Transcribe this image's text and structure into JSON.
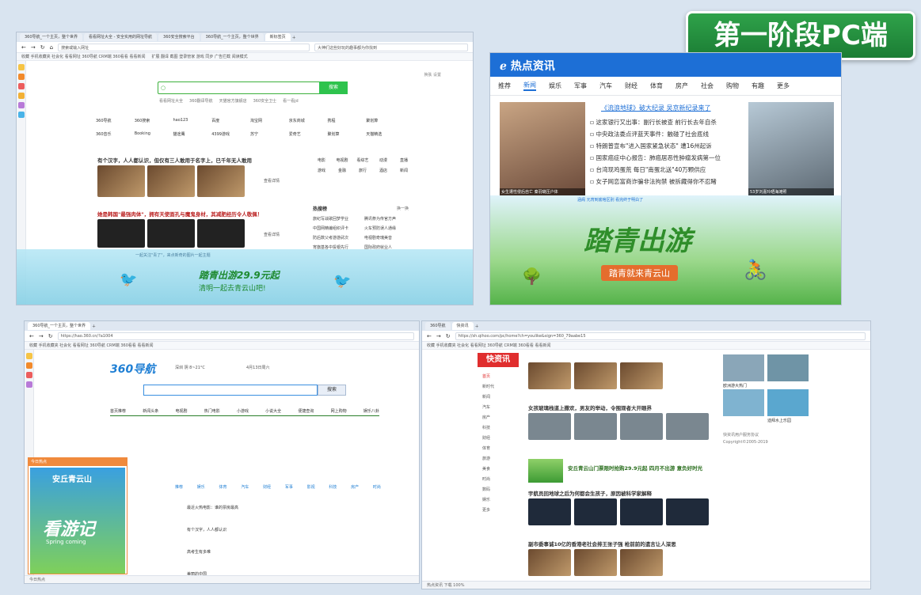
{
  "badge": "第一阶段PC端",
  "win1": {
    "tabs": [
      "360导航_一个主页，整个世界",
      "看看网址大全 - 安全实用的网址导航",
      "360安全搜索平台",
      "360导航_一个主页，整个世界",
      "新标签页"
    ],
    "url": "搜索或输入网址",
    "url_right": "大神们这些好玩的趣事都为你找到",
    "favs": "收藏  手机收藏夹  社会化  看看网址  360导航  CRM端  360看看  看看新闻",
    "fav_right": "扩展  翻译  截图  登录管家  游戏  同步  广告拦截  阅读模式",
    "top_right": "换肤   设置",
    "search_button": "搜索",
    "search_links": [
      "看看网址大全",
      "360翻译导航",
      "天猫官方旗舰店",
      "360安全卫士",
      "看一看jd"
    ],
    "sites_row1": [
      "360导航",
      "360搜索",
      "hao123",
      "百度",
      "淘宝网",
      "京东商城",
      "携程",
      "聚划算"
    ],
    "sites_row2": [
      "360音乐",
      "Booking",
      "猫途鹰",
      "4399游戏",
      "苏宁",
      "爱奇艺",
      "聚划算",
      "天猫精选"
    ],
    "headline1": "有个汉字，人人都认识，但仅有三人敢用于名字上，已千年无人敢用",
    "headline2": "她是韩国\"最强肉体\"，拥有天使面孔与魔鬼身材，其减肥经历令人敬佩！",
    "view_detail": "查看详情",
    "grid_icons": [
      "电影",
      "电视剧",
      "看综艺",
      "动漫",
      "直播",
      "游戏",
      "金融",
      "旅行",
      "酒店",
      "新闻"
    ],
    "hot_title": "热搜榜",
    "hot_refresh": "换一换",
    "hot_items": [
      "旅纪写战歌回梦学业",
      "腾讯祭为传官方声",
      "中国网精编组织评卡",
      "火车预防误人通缘",
      "防后数父考游游武次",
      "电视剧奇瑰美音",
      "宵旗基各中投银先行",
      "国际政府就业人"
    ],
    "banner_text": "踏青出游29.9元起",
    "banner_sub": "清明一起去青云山吧!",
    "ad_text": "一起关注\"青了\"，来点新奇的图片一起主题"
  },
  "news": {
    "brand": "热点资讯",
    "tabs": [
      "推荐",
      "新闻",
      "娱乐",
      "军事",
      "汽车",
      "财经",
      "体育",
      "房产",
      "社会",
      "购物",
      "有趣",
      "更多"
    ],
    "headline": "《流浪地球》破大纪录 吴京新纪录来了",
    "items": [
      "这家银行又出事：副行长被查 前行长去年自杀",
      "中央政法委点评蓝天事件：触碰了社会底线",
      "特朗普宣布\"进入国家紧急状态\" 遭16州起诉",
      "国家癌症中心报告：肺癌居恶性肿瘤发病第一位",
      "台湾现鸡蛋荒 每日\"南蛋北送\"40万颗供应",
      "女子网恋富商诈骗非法拘禁 被拆藏得你不忍睹"
    ],
    "left_caption": "女生遭性侵后自亡 秦羽璐压户体",
    "right_caption": "53岁刘嘉玲晒海滩照",
    "bottom_line": "涵阁 元宵到底啥区别 看完终于明白了",
    "poster_title": "踏青出游",
    "poster_sub": "踏青就来青云山"
  },
  "win3": {
    "url": "https://hao.360.cn/?a1004",
    "logo": "360导航",
    "weather": "深圳 阴 8~21°C",
    "date": "4月13日周六",
    "search_button": "搜索",
    "nav": [
      "首页推荐",
      "新闻头条",
      "电视剧",
      "热门电影",
      "小游戏",
      "小说大全",
      "便捷查询",
      "网上购物",
      "娱乐八卦"
    ],
    "popup_title": "今日热点",
    "popup_brand": "安丘青云山",
    "popup_word": "看游记",
    "popup_sub": "Spring coming",
    "news_tabs": [
      "推荐",
      "娱乐",
      "体育",
      "汽车",
      "财经",
      "军事",
      "影视",
      "科技",
      "房产",
      "时尚"
    ],
    "news_items": [
      "最近火热电影：谁的票房最高",
      "有个汉字，人人都认识",
      "高考生有多难",
      "美丽的中国"
    ],
    "status": "今日热点"
  },
  "win4": {
    "url": "https://sh.qihoo.com/pc/home?ch=youlike&sign=360_79aabe15",
    "brand": "快资讯",
    "side_nav": [
      "首页",
      "新时代",
      "新闻",
      "汽车",
      "房产",
      "科技",
      "财经",
      "体育",
      "旅游",
      "美食",
      "时尚",
      "数码",
      "娱乐",
      "更多"
    ],
    "story1": "女孩玻璃栈道上撒欢，男友的举动，令围观者大开眼界",
    "story2": "安丘青云山门票限时抢购29.9元起 四月不出游 意负好时光",
    "story3": "宇航员回地球之后为何都会生孩子，原因被科学家解释",
    "story4": "副市委事诚10亿的香港老社会排王张子强 枪前前的遗言让人深思",
    "right_caption1": "欧洲游大热门",
    "right_caption2": "迪拜水上乐园",
    "right_info": "快资讯用户服务协议",
    "copyright": "Copyright©2005-2019",
    "status": "热点资讯 下载 100%"
  }
}
